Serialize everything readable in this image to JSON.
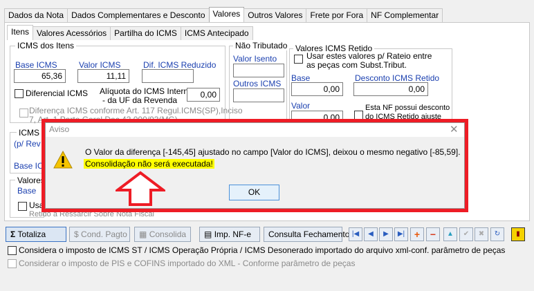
{
  "outer_tabs": [
    "Dados da Nota",
    "Dados Complementares e Desconto",
    "Valores",
    "Outros Valores",
    "Frete por Fora",
    "NF Complementar"
  ],
  "inner_tabs": [
    "Itens",
    "Valores Acessórios",
    "Partilha do ICMS",
    "ICMS Antecipado"
  ],
  "icms_itens": {
    "title": "ICMS dos Itens",
    "base_label": "Base ICMS",
    "base_value": "65,36",
    "valor_label": "Valor ICMS",
    "valor_value": "11,11",
    "dif_label": "Dif. ICMS Reduzido",
    "diferencial_label": "Diferencial ICMS",
    "aliquota_label_1": "Alíquota do ICMS Interna",
    "aliquota_label_2": "- da UF da Revenda",
    "aliquota_value": "0,00",
    "diferenca_line1": "Diferença ICMS conforme Art. 117 Regul.ICMS(SP),Inciso",
    "diferenca_line2": "7, Art. 1 Parte Geral Dec.43.000/93(MG)"
  },
  "icms_st": {
    "title_partial": "ICMS O",
    "sub_partial": "(p/ Rev",
    "base_partial": "Base ICM"
  },
  "valores_partial": {
    "title": "Valores",
    "base_label": "Base",
    "cb_label": "Usa",
    "retido_partial": "Retido a Ressarcir Sobre Nota Fiscal"
  },
  "nao_tributado": {
    "title": "Não Tributado",
    "isento_label": "Valor Isento",
    "outros_label": "Outros ICMS"
  },
  "retido": {
    "title": "Valores ICMS Retido",
    "usar_line1": "Usar estes valores p/ Rateio  entre",
    "usar_line2": "as peças com Subst.Tribut.",
    "base_label": "Base",
    "base_value": "0,00",
    "desconto_label": "Desconto ICMS Retido",
    "desconto_value": "0,00",
    "valor_label": "Valor",
    "valor_value": "0,00",
    "nf_line1": "Esta NF possui desconto",
    "nf_line2": "do ICMS Retido ajuste"
  },
  "toolbar": {
    "totaliza": "Totaliza",
    "cond_pagto": "Cond. Pagto",
    "consolida": "Consolida",
    "imp_nfe": "Imp.  NF-e",
    "consulta": "Consulta Fechamento"
  },
  "check1": "Considera o imposto de ICMS ST / ICMS Operação Própria / ICMS Desonerado importado do arquivo xml-conf. parâmetro de peças",
  "check2": "Considerar o imposto de PIS e COFINS importado do XML - Conforme parâmetro de peças",
  "dialog": {
    "title": "Aviso",
    "message": "O Valor da diferença [-145,45] ajustado no campo [Valor do ICMS], deixou o mesmo negativo [-85,59].",
    "highlight": "Consolidação não será executada!",
    "ok": "OK"
  },
  "colors": {
    "annotation_red": "#ee1c25",
    "highlight_yellow": "#ffff00",
    "label_blue": "#1a3faf"
  }
}
